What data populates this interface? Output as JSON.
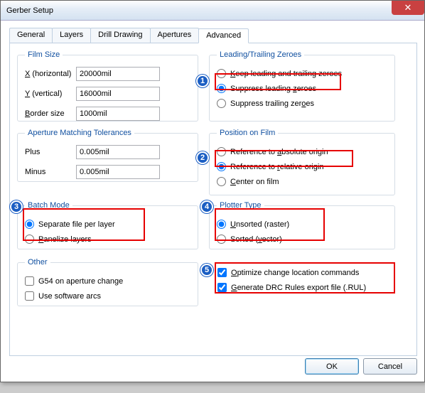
{
  "title": "Gerber Setup",
  "tabs": [
    "General",
    "Layers",
    "Drill Drawing",
    "Apertures",
    "Advanced"
  ],
  "active_tab": 4,
  "film_size": {
    "legend": "Film Size",
    "x_label_pre": "X",
    "x_label_post": " (horizontal)",
    "x_value": "20000mil",
    "y_label_pre": "Y",
    "y_label_post": " (vertical)",
    "y_value": "16000mil",
    "b_label_pre": "B",
    "b_label_post": "order size",
    "b_value": "1000mil"
  },
  "aperture": {
    "legend": "Aperture Matching Tolerances",
    "plus_label": "Plus",
    "plus_value": "0.005mil",
    "minus_label": "Minus",
    "minus_value": "0.005mil"
  },
  "batch": {
    "legend": "Batch Mode",
    "opt1": "Separate file per layer",
    "opt2_pre": "P",
    "opt2_post": "anelize layers",
    "selected": 0
  },
  "other": {
    "legend": "Other",
    "c1": "G54 on aperture change",
    "c2": "Use software arcs",
    "c1_checked": false,
    "c2_checked": false
  },
  "zeroes": {
    "legend": "Leading/Trailing Zeroes",
    "opt1_pre": "K",
    "opt1_post": "eep leading and trailing zeroes",
    "opt2": "Suppress leading ",
    "opt2_u": "z",
    "opt2_post": "eroes",
    "opt3": "Suppress trailing zer",
    "opt3_u": "o",
    "opt3_post": "es",
    "selected": 1
  },
  "position": {
    "legend": "Position on Film",
    "opt1": "Reference to ",
    "opt1_u": "a",
    "opt1_post": "bsolute origin",
    "opt2": "Reference to ",
    "opt2_u": "r",
    "opt2_post": "elative origin",
    "opt3_pre": "C",
    "opt3_post": "enter on film",
    "selected": 1
  },
  "plotter": {
    "legend": "Plotter Type",
    "opt1_pre": "U",
    "opt1_post": "nsorted (raster)",
    "opt2": "Sorted (",
    "opt2_u": "v",
    "opt2_post": "ector)",
    "selected": 0
  },
  "opts": {
    "c1_pre": "O",
    "c1_post": "ptimize change location commands",
    "c2_pre": "G",
    "c2_post": "enerate DRC Rules export file (.RUL)",
    "c1_checked": true,
    "c2_checked": true
  },
  "buttons": {
    "ok": "OK",
    "cancel": "Cancel"
  },
  "badges": [
    "1",
    "2",
    "3",
    "4",
    "5"
  ]
}
